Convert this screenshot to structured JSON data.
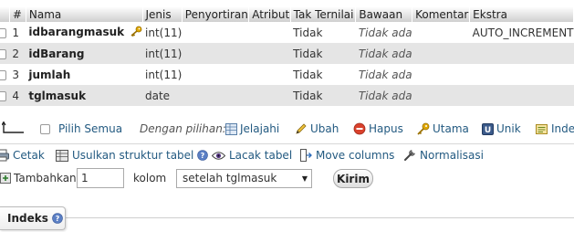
{
  "table": {
    "headers": [
      "#",
      "Nama",
      "Jenis",
      "Penyortiran",
      "Atribut",
      "Tak Ternilai",
      "Bawaan",
      "Komentar",
      "Ekstra"
    ],
    "rows": [
      {
        "no": "1",
        "nama": "idbarangmasuk",
        "jenis": "int(11)",
        "penyortiran": "",
        "atribut": "",
        "tak_ternilai": "Tidak",
        "bawaan": "Tidak ada",
        "komentar": "",
        "ekstra": "AUTO_INCREMENT",
        "primary_key": true
      },
      {
        "no": "2",
        "nama": "idBarang",
        "jenis": "int(11)",
        "penyortiran": "",
        "atribut": "",
        "tak_ternilai": "Tidak",
        "bawaan": "Tidak ada",
        "komentar": "",
        "ekstra": "",
        "primary_key": false
      },
      {
        "no": "3",
        "nama": "jumlah",
        "jenis": "int(11)",
        "penyortiran": "",
        "atribut": "",
        "tak_ternilai": "Tidak",
        "bawaan": "Tidak ada",
        "komentar": "",
        "ekstra": "",
        "primary_key": false
      },
      {
        "no": "4",
        "nama": "tglmasuk",
        "jenis": "date",
        "penyortiran": "",
        "atribut": "",
        "tak_ternilai": "Tidak",
        "bawaan": "Tidak ada",
        "komentar": "",
        "ekstra": "",
        "primary_key": false
      }
    ]
  },
  "actions": {
    "select_all": "Pilih Semua",
    "with_selected": "Dengan pilihan:",
    "browse": "Jelajahi",
    "change": "Ubah",
    "drop": "Hapus",
    "primary": "Utama",
    "unique": "Unik",
    "index": "Inde"
  },
  "tools": {
    "print": "Cetak",
    "propose": "Usulkan struktur tabel",
    "track": "Lacak tabel",
    "move_columns": "Move columns",
    "normalize": "Normalisasi"
  },
  "add": {
    "label": "Tambahkan",
    "count": "1",
    "columns_label": "kolom",
    "position": "setelah tglmasuk",
    "submit": "Kirim"
  },
  "indexes": {
    "tab_label": "Indeks"
  },
  "colors": {
    "link": "#235a81",
    "row_even": "#e5e5e5",
    "header_grad_end": "#cfcfcf",
    "drop_red": "#d9412c",
    "key_gold": "#e0a800"
  }
}
